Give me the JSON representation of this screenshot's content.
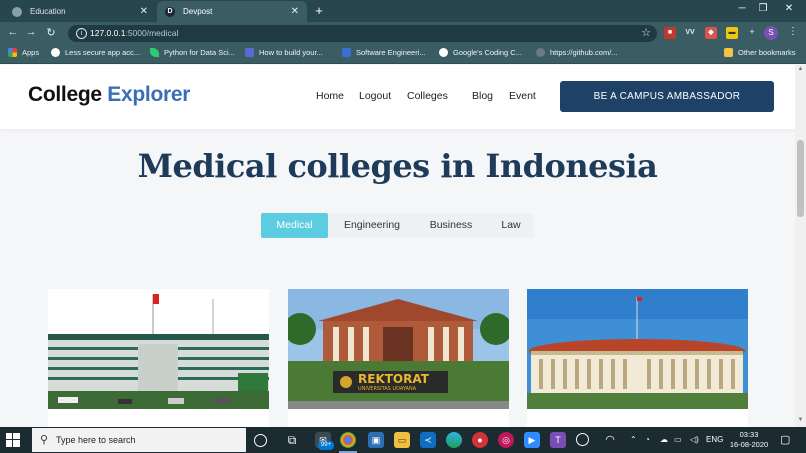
{
  "browser": {
    "tabs": [
      {
        "title": "Education",
        "active": false
      },
      {
        "title": "Devpost",
        "active": true,
        "favicon_letter": "D"
      }
    ],
    "url_host": "127.0.0.1",
    "url_path": ":5000/medical",
    "bookmarks": [
      {
        "label": "Apps",
        "icon": "apps-grid-icon"
      },
      {
        "label": "Less secure app acc...",
        "icon": "google-icon"
      },
      {
        "label": "Python for Data Sci...",
        "icon": "leaf-icon"
      },
      {
        "label": "How to build your...",
        "icon": "site-icon"
      },
      {
        "label": "Software Engineeri...",
        "icon": "folder-icon"
      },
      {
        "label": "Google's Coding C...",
        "icon": "google-icon"
      },
      {
        "label": "https://github.com/...",
        "icon": "github-icon"
      }
    ],
    "other_bookmarks": "Other bookmarks",
    "profile_initial": "S"
  },
  "site": {
    "brand_first": "College",
    "brand_second": "Explorer",
    "nav": [
      "Home",
      "Logout",
      "Colleges",
      "Blog",
      "Event"
    ],
    "cta_label": "BE A CAMPUS AMBASSADOR"
  },
  "main": {
    "title": "Medical colleges in Indonesia",
    "filters": [
      {
        "label": "Medical",
        "active": true
      },
      {
        "label": "Engineering",
        "active": false
      },
      {
        "label": "Business",
        "active": false
      },
      {
        "label": "Law",
        "active": false
      }
    ],
    "cards": [
      {
        "photo": "government-building-photo",
        "sign_text": ""
      },
      {
        "photo": "rektorat-building-photo",
        "sign_text": "REKTORAT",
        "sign_subtext": "UNIVERSITAS UDAYANA"
      },
      {
        "photo": "colonnade-building-photo",
        "sign_text": ""
      }
    ]
  },
  "taskbar": {
    "search_placeholder": "Type here to search",
    "badge_count": "99+",
    "language": "ENG",
    "time": "03:33",
    "date": "16-08-2020"
  },
  "colors": {
    "brand_accent": "#3a6fb5",
    "cta_bg": "#1e4266",
    "filter_active": "#5ccde0",
    "title_color": "#1f3b5a"
  }
}
